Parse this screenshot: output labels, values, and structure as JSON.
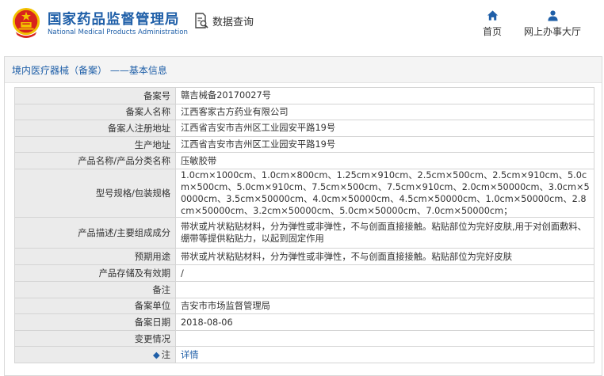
{
  "header": {
    "org_name_cn": "国家药品监督管理局",
    "org_name_en": "National Medical Products Administration",
    "query_label": "数据查询",
    "nav": [
      {
        "label": "首页",
        "icon": "home-icon"
      },
      {
        "label": "网上办事大厅",
        "icon": "user-icon"
      }
    ]
  },
  "panel": {
    "title": "境内医疗器械（备案） ——基本信息"
  },
  "record": {
    "rows": [
      {
        "key": "备案号",
        "value": "赣吉械备20170027号"
      },
      {
        "key": "备案人名称",
        "value": "江西客家古方药业有限公司"
      },
      {
        "key": "备案人注册地址",
        "value": "江西省吉安市吉州区工业园安平路19号"
      },
      {
        "key": "生产地址",
        "value": "江西省吉安市吉州区工业园安平路19号"
      },
      {
        "key": "产品名称/产品分类名称",
        "value": "压敏胶带"
      },
      {
        "key": "型号规格/包装规格",
        "value": "1.0cm×1000cm、1.0cm×800cm、1.25cm×910cm、2.5cm×500cm、2.5cm×910cm、5.0cm×500cm、5.0cm×910cm、7.5cm×500cm、7.5cm×910cm、2.0cm×50000cm、3.0cm×50000cm、3.5cm×50000cm、4.0cm×50000cm、4.5cm×50000cm、1.0cm×50000cm、2.8cm×50000cm、3.2cm×50000cm、5.0cm×50000cm、7.0cm×50000cm；"
      },
      {
        "key": "产品描述/主要组成成分",
        "value": "带状或片状粘贴材料，分为弹性或非弹性，不与创面直接接触。粘贴部位为完好皮肤,用于对创面敷料、绷带等提供粘贴力，以起到固定作用"
      },
      {
        "key": "预期用途",
        "value": "带状或片状粘贴材料，分为弹性或非弹性，不与创面直接接触。粘贴部位为完好皮肤"
      },
      {
        "key": "产品存储及有效期",
        "value": "/"
      },
      {
        "key": "备注",
        "value": ""
      },
      {
        "key": "备案单位",
        "value": "吉安市市场监督管理局"
      },
      {
        "key": "备案日期",
        "value": "2018-08-06"
      },
      {
        "key": "变更情况",
        "value": ""
      }
    ],
    "note_row": {
      "key": "注",
      "link": "详情"
    }
  },
  "colors": {
    "brand_blue": "#1f5fa8",
    "emblem_red": "#d8241c",
    "emblem_gold": "#f2c200"
  }
}
